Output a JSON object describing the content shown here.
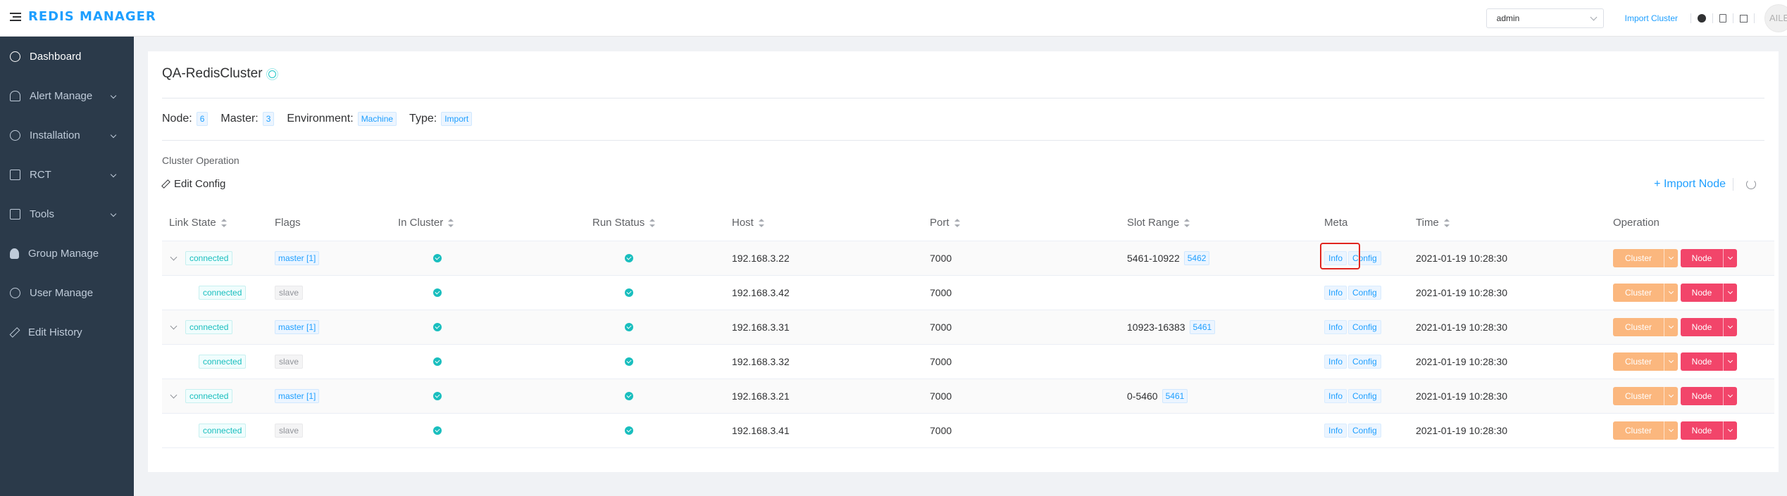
{
  "header": {
    "brand": "REDIS MANAGER",
    "user_select": "admin",
    "import_cluster": "Import Cluster",
    "avatar_text": "AILEI"
  },
  "sidebar": {
    "items": [
      {
        "label": "Dashboard",
        "icon": "dashboard-icon",
        "active": true,
        "has_children": false
      },
      {
        "label": "Alert Manage",
        "icon": "bell-icon",
        "active": false,
        "has_children": true
      },
      {
        "label": "Installation",
        "icon": "gear-icon",
        "active": false,
        "has_children": true
      },
      {
        "label": "RCT",
        "icon": "chip-icon",
        "active": false,
        "has_children": true
      },
      {
        "label": "Tools",
        "icon": "toolbox-icon",
        "active": false,
        "has_children": true
      },
      {
        "label": "Group Manage",
        "icon": "group-icon",
        "active": false,
        "has_children": false
      },
      {
        "label": "User Manage",
        "icon": "user-icon",
        "active": false,
        "has_children": false
      },
      {
        "label": "Edit History",
        "icon": "edit-icon",
        "active": false,
        "has_children": false
      }
    ]
  },
  "cluster": {
    "title": "QA-RedisCluster",
    "node_label": "Node:",
    "node_value": "6",
    "master_label": "Master:",
    "master_value": "3",
    "env_label": "Environment:",
    "env_value": "Machine",
    "type_label": "Type:",
    "type_value": "Import",
    "ops_label": "Cluster Operation",
    "edit_config": "Edit Config",
    "import_node": "+ Import Node"
  },
  "table": {
    "headers": {
      "link_state": "Link State",
      "flags": "Flags",
      "in_cluster": "In Cluster",
      "run_status": "Run Status",
      "host": "Host",
      "port": "Port",
      "slot_range": "Slot Range",
      "meta": "Meta",
      "time": "Time",
      "operation": "Operation"
    },
    "info_label": "Info",
    "config_label": "Config",
    "cluster_btn": "Cluster",
    "node_btn": "Node",
    "rows": [
      {
        "master": true,
        "link": "connected",
        "flag": "master [1]",
        "host": "192.168.3.22",
        "port": "7000",
        "slot": "5461-10922",
        "slot_count": "5462",
        "time": "2021-01-19 10:28:30",
        "highlight": true
      },
      {
        "master": false,
        "link": "connected",
        "flag": "slave",
        "host": "192.168.3.42",
        "port": "7000",
        "slot": "",
        "slot_count": "",
        "time": "2021-01-19 10:28:30"
      },
      {
        "master": true,
        "link": "connected",
        "flag": "master [1]",
        "host": "192.168.3.31",
        "port": "7000",
        "slot": "10923-16383",
        "slot_count": "5461",
        "time": "2021-01-19 10:28:30"
      },
      {
        "master": false,
        "link": "connected",
        "flag": "slave",
        "host": "192.168.3.32",
        "port": "7000",
        "slot": "",
        "slot_count": "",
        "time": "2021-01-19 10:28:30"
      },
      {
        "master": true,
        "link": "connected",
        "flag": "master [1]",
        "host": "192.168.3.21",
        "port": "7000",
        "slot": "0-5460",
        "slot_count": "5461",
        "time": "2021-01-19 10:28:30"
      },
      {
        "master": false,
        "link": "connected",
        "flag": "slave",
        "host": "192.168.3.41",
        "port": "7000",
        "slot": "",
        "slot_count": "",
        "time": "2021-01-19 10:28:30"
      }
    ]
  },
  "colors": {
    "accent": "#1e9fff",
    "sidebar_bg": "#2b3a4a",
    "status_green": "#19bebe",
    "cluster_btn": "#fbb77e",
    "node_btn": "#f2456a",
    "highlight": "#e0251f"
  }
}
